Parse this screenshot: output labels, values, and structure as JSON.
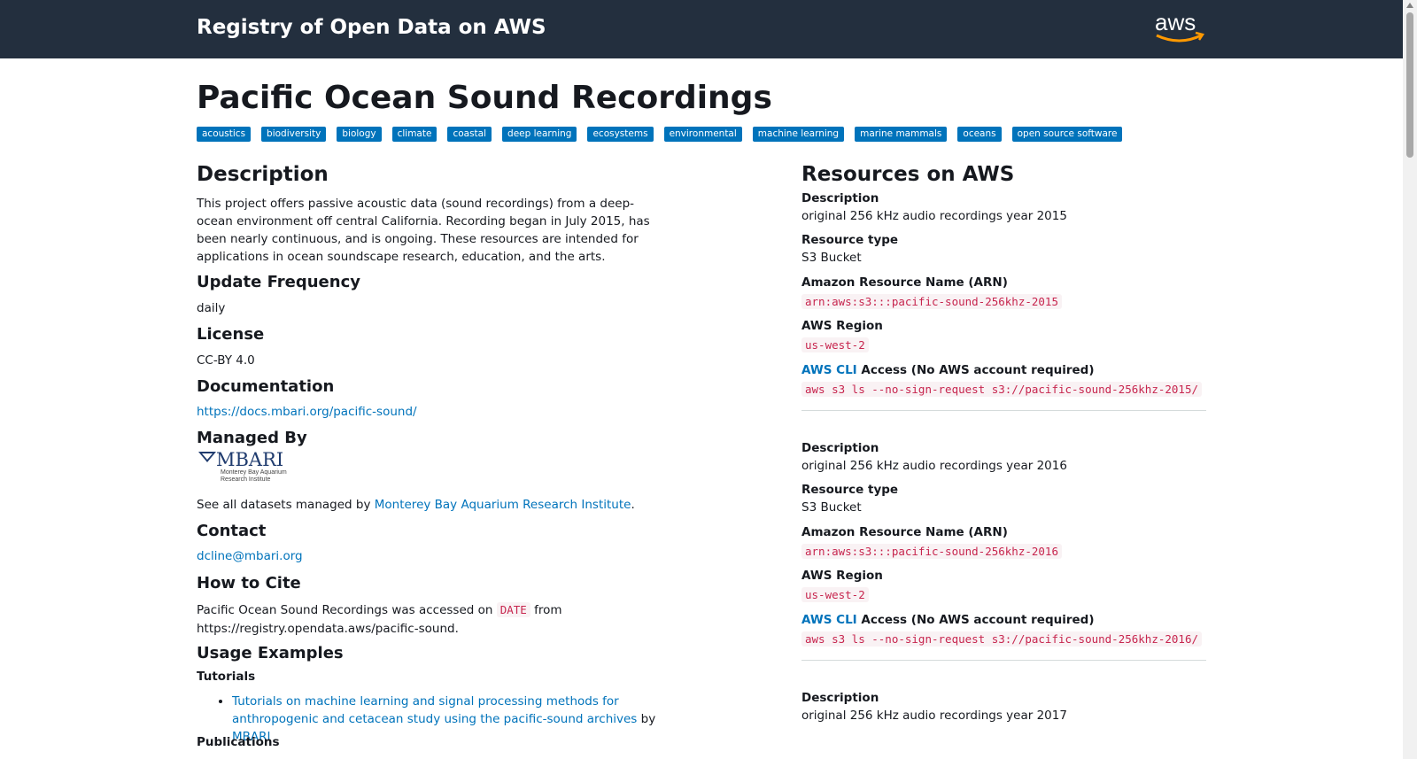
{
  "header": {
    "site_title": "Registry of Open Data on AWS",
    "logo_text": "aws"
  },
  "dataset": {
    "title": "Pacific Ocean Sound Recordings",
    "tags": [
      "acoustics",
      "biodiversity",
      "biology",
      "climate",
      "coastal",
      "deep learning",
      "ecosystems",
      "environmental",
      "machine learning",
      "marine mammals",
      "oceans",
      "open source software"
    ]
  },
  "left": {
    "description_heading": "Description",
    "description_text": "This project offers passive acoustic data (sound recordings) from a deep-ocean environment off central California. Recording began in July 2015, has been nearly continuous, and is ongoing. These resources are intended for applications in ocean soundscape research, education, and the arts.",
    "update_frequency_heading": "Update Frequency",
    "update_frequency": "daily",
    "license_heading": "License",
    "license": "CC-BY 4.0",
    "documentation_heading": "Documentation",
    "documentation_link": "https://docs.mbari.org/pacific-sound/",
    "managed_by_heading": "Managed By",
    "managed_logo_main": "MBARI",
    "managed_logo_sub1": "Monterey Bay Aquarium",
    "managed_logo_sub2": "Research Institute",
    "see_all_prefix": "See all datasets managed by",
    "see_all_link": "Monterey Bay Aquarium Research Institute",
    "see_all_suffix": ".",
    "contact_heading": "Contact",
    "contact_email": "dcline@mbari.org",
    "cite_heading": "How to Cite",
    "cite_prefix": "Pacific Ocean Sound Recordings was accessed on",
    "cite_date": "DATE",
    "cite_from": "from",
    "cite_url": "https://registry.opendata.aws/pacific-sound.",
    "usage_heading": "Usage Examples",
    "tutorials_heading": "Tutorials",
    "tutorial_link": "Tutorials on machine learning and signal processing methods for anthropogenic and cetacean study using the pacific-sound archives",
    "tutorial_by": "by",
    "tutorial_author": "MBARI",
    "publications_heading": "Publications"
  },
  "right": {
    "heading": "Resources on AWS",
    "labels": {
      "description": "Description",
      "resource_type": "Resource type",
      "arn": "Amazon Resource Name (ARN)",
      "region": "AWS Region",
      "cli_link": "AWS CLI",
      "cli_access": "Access (No AWS account required)"
    },
    "resources": [
      {
        "description": "original 256 kHz audio recordings year 2015",
        "type": "S3 Bucket",
        "arn": "arn:aws:s3:::pacific-sound-256khz-2015",
        "region": "us-west-2",
        "cli": "aws s3 ls --no-sign-request s3://pacific-sound-256khz-2015/"
      },
      {
        "description": "original 256 kHz audio recordings year 2016",
        "type": "S3 Bucket",
        "arn": "arn:aws:s3:::pacific-sound-256khz-2016",
        "region": "us-west-2",
        "cli": "aws s3 ls --no-sign-request s3://pacific-sound-256khz-2016/"
      },
      {
        "description": "original 256 kHz audio recordings year 2017"
      }
    ]
  }
}
